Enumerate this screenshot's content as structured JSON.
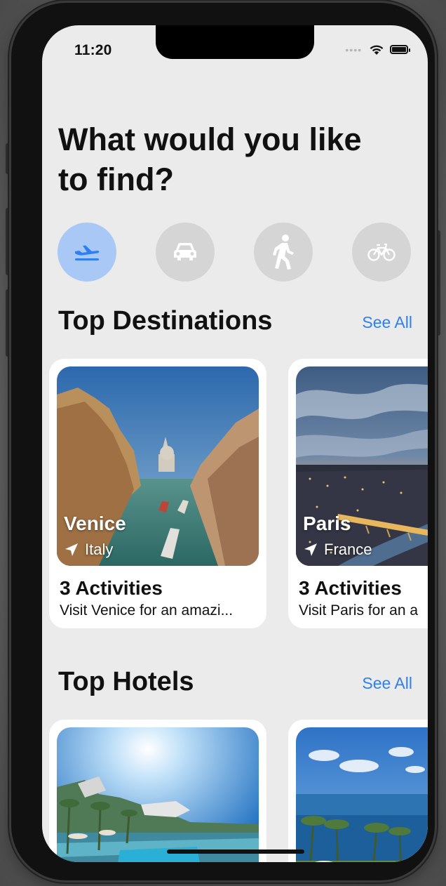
{
  "status_bar": {
    "time": "11:20",
    "signal_icon": "cellular-dots-icon",
    "wifi_icon": "wifi-icon",
    "battery_icon": "battery-icon"
  },
  "headline": "What would you like to find?",
  "categories": [
    {
      "icon": "airplane-icon",
      "active": true
    },
    {
      "icon": "car-icon",
      "active": false
    },
    {
      "icon": "walking-person-icon",
      "active": false
    },
    {
      "icon": "bicycle-icon",
      "active": false
    }
  ],
  "destinations": {
    "title": "Top Destinations",
    "see_all": "See All",
    "cards": [
      {
        "city": "Venice",
        "country": "Italy",
        "activities": "3 Activities",
        "description": "Visit Venice for an amazi..."
      },
      {
        "city": "Paris",
        "country": "France",
        "activities": "3 Activities",
        "description": "Visit Paris for an a"
      }
    ]
  },
  "hotels": {
    "title": "Top Hotels",
    "see_all": "See All"
  },
  "colors": {
    "accent": "#2f7ff0",
    "active_category": "#a9c8f5",
    "inactive_category": "#d5d5d5",
    "background": "#ebebeb"
  }
}
